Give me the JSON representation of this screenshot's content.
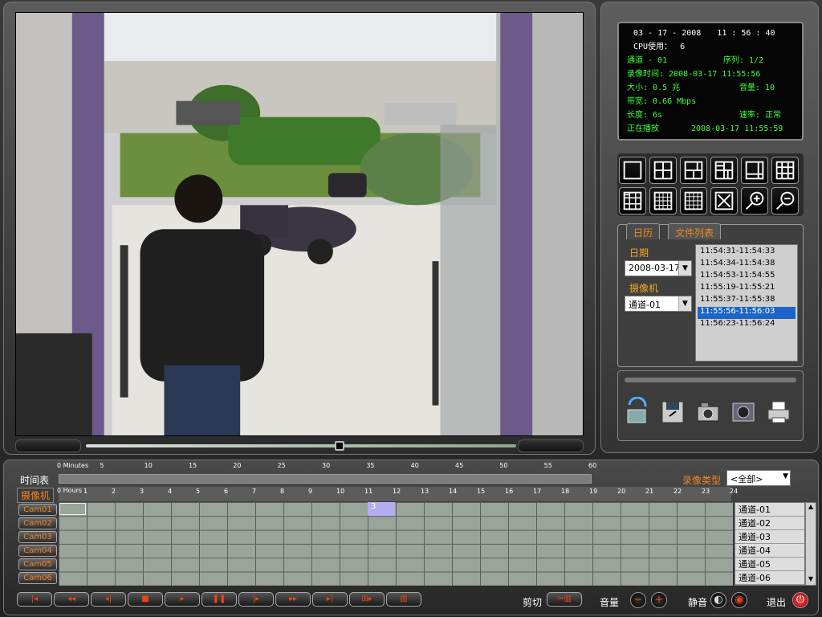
{
  "status": {
    "date": "03 - 17 - 2008",
    "time": "11 : 56 : 40",
    "cpu_label": "CPU使用：",
    "cpu_value": "6",
    "channel_label": "通道 - 01",
    "seq_label": "序列: 1/2",
    "rec_time": "录像时间: 2008-03-17 11:55:56",
    "size": "大小: 0.5 兆",
    "volume": "音量: 10",
    "bandwidth": "带宽: 0.66 Mbps",
    "length": "长度: 6s",
    "rate": "速率: 正常",
    "playing": "正在播放",
    "playing_time": "2008-03-17 11:55:59"
  },
  "tabs": {
    "calendar": "日历",
    "filelist": "文件列表"
  },
  "filter": {
    "date_label": "日期",
    "date_value": "2008-03-17",
    "camera_label": "摄像机",
    "camera_value": "通道-01"
  },
  "files": [
    "11:54:31-11:54:33",
    "11:54:34-11:54:38",
    "11:54:53-11:54:55",
    "11:55:19-11:55:21",
    "11:55:37-11:55:38",
    "11:55:56-11:56:03",
    "11:56:23-11:56:24"
  ],
  "timeline": {
    "schedule_label": "时间表",
    "camera_label": "摄像机",
    "minutes_label": "Minutes",
    "hours_label": "Hours",
    "minute_ticks": [
      "0",
      "5",
      "10",
      "15",
      "20",
      "25",
      "30",
      "35",
      "40",
      "45",
      "50",
      "55",
      "60"
    ],
    "hour_ticks": [
      "0",
      "1",
      "2",
      "3",
      "4",
      "5",
      "6",
      "7",
      "8",
      "9",
      "10",
      "11",
      "12",
      "13",
      "14",
      "15",
      "16",
      "17",
      "18",
      "19",
      "20",
      "21",
      "22",
      "23",
      "24"
    ],
    "rec_type_label": "录像类型",
    "rec_type_value": "<全部>",
    "rec_block_label": "3"
  },
  "cameras": [
    "Cam01",
    "Cam02",
    "Cam03",
    "Cam04",
    "Cam05",
    "Cam06"
  ],
  "channels": [
    "通道-01",
    "通道-02",
    "通道-03",
    "通道-04",
    "通道-05",
    "通道-06"
  ],
  "controls": {
    "cut_label": "剪切",
    "volume_label": "音量",
    "mute_label": "静音",
    "exit_label": "退出"
  }
}
